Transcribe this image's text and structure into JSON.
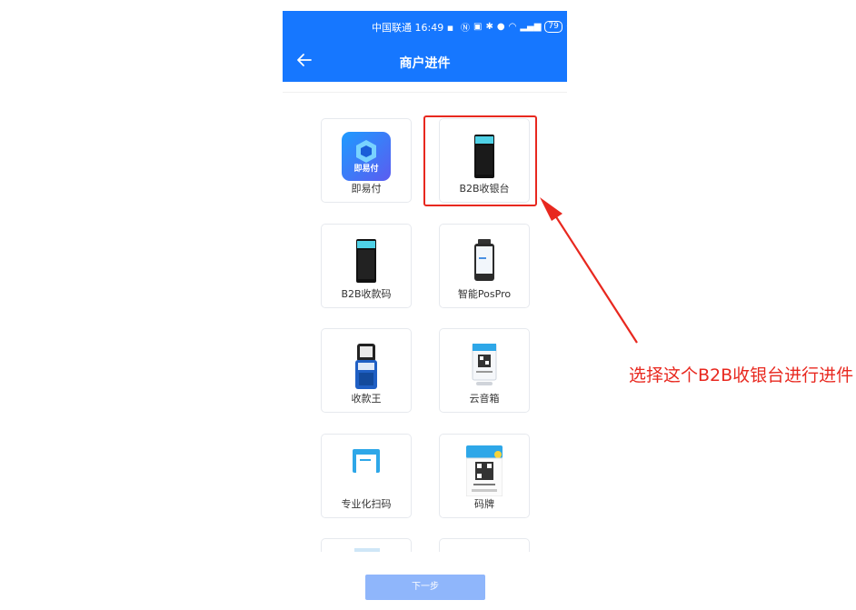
{
  "statusbar": {
    "carrier": "中国联通",
    "time": "16:49",
    "battery": "79"
  },
  "navbar": {
    "title": "商户进件"
  },
  "products": [
    {
      "label": "即易付",
      "logo_text": "即易付"
    },
    {
      "label": "B2B收银台"
    },
    {
      "label": "B2B收款码"
    },
    {
      "label": "智能PosPro"
    },
    {
      "label": "收款王"
    },
    {
      "label": "云音箱"
    },
    {
      "label": "专业化扫码"
    },
    {
      "label": "码牌"
    }
  ],
  "annotation": {
    "text": "选择这个B2B收银台进行进件"
  },
  "footer": {
    "next_label": "下一步"
  },
  "colors": {
    "primary": "#1677ff",
    "annotation": "#e8281f",
    "disabled_button": "#8fb6fb"
  }
}
